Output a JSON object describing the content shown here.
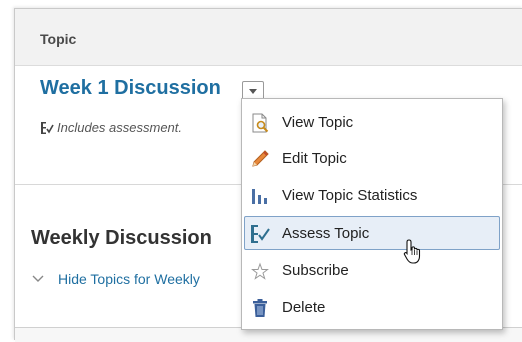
{
  "panel": {
    "header_label": "Topic",
    "topic_title": "Week 1 Discussion",
    "assessment_note": "Includes assessment."
  },
  "context_menu": {
    "items": [
      {
        "label": "View Topic",
        "icon": "view-topic-icon"
      },
      {
        "label": "Edit Topic",
        "icon": "pencil-icon"
      },
      {
        "label": "View Topic Statistics",
        "icon": "statistics-icon"
      },
      {
        "label": "Assess Topic",
        "icon": "assess-icon",
        "highlighted": true
      },
      {
        "label": "Subscribe",
        "icon": "star-icon"
      },
      {
        "label": "Delete",
        "icon": "trash-icon"
      }
    ]
  },
  "section": {
    "heading": "Weekly Discussion",
    "hide_link": "Hide Topics for Weekly"
  },
  "colors": {
    "link_blue": "#1f6fa1",
    "highlight_bg": "#e7eef7",
    "highlight_border": "#7fa2c8"
  }
}
